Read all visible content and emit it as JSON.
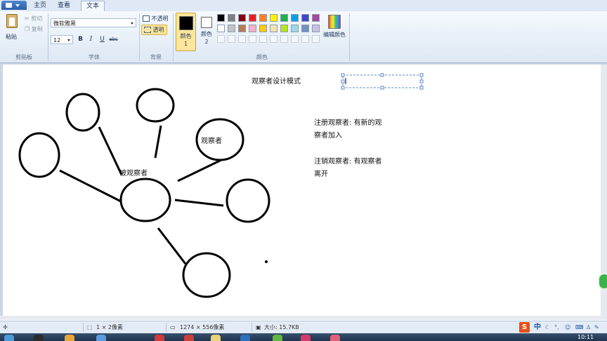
{
  "tabs": [
    "主页",
    "查看",
    "文本"
  ],
  "ribbon": {
    "clipboard": {
      "paste": "粘贴",
      "cut": "剪切",
      "copy": "复制",
      "label": "剪贴板"
    },
    "font": {
      "family": "微软雅黑",
      "size": "12",
      "bold": "B",
      "italic": "I",
      "underline": "U",
      "strike": "abc",
      "label": "字体"
    },
    "background": {
      "opaque": "不透明",
      "transparent": "透明",
      "label": "背景"
    },
    "colors": {
      "color1_label": "颜色 1",
      "color2_label": "颜色 2",
      "edit": "编辑颜色",
      "label": "颜色",
      "row1": [
        "#000000",
        "#7f7f7f",
        "#880015",
        "#ed1c24",
        "#ff7f27",
        "#fff200",
        "#22b14c",
        "#00a2e8",
        "#3f48cc",
        "#a349a4"
      ],
      "row2": [
        "#ffffff",
        "#c3c3c3",
        "#b97a57",
        "#ffaec9",
        "#ffc90e",
        "#efe4b0",
        "#b5e61d",
        "#99d9ea",
        "#7092be",
        "#c8bfe7"
      ]
    }
  },
  "canvas": {
    "title": "观察者设计模式",
    "subject_label": "被观察者",
    "observer_label": "观察者",
    "note1_line1": "注册观察者: 有新的观",
    "note1_line2": "察者加入",
    "note2_line1": "注销观察者: 有观察者",
    "note2_line2": "离开"
  },
  "status": {
    "selection": "1 × 2像素",
    "image_size": "1274 × 556像素",
    "file_size": "大小: 15.7KB"
  },
  "tray": {
    "ime": "中",
    "time": "10:11"
  }
}
